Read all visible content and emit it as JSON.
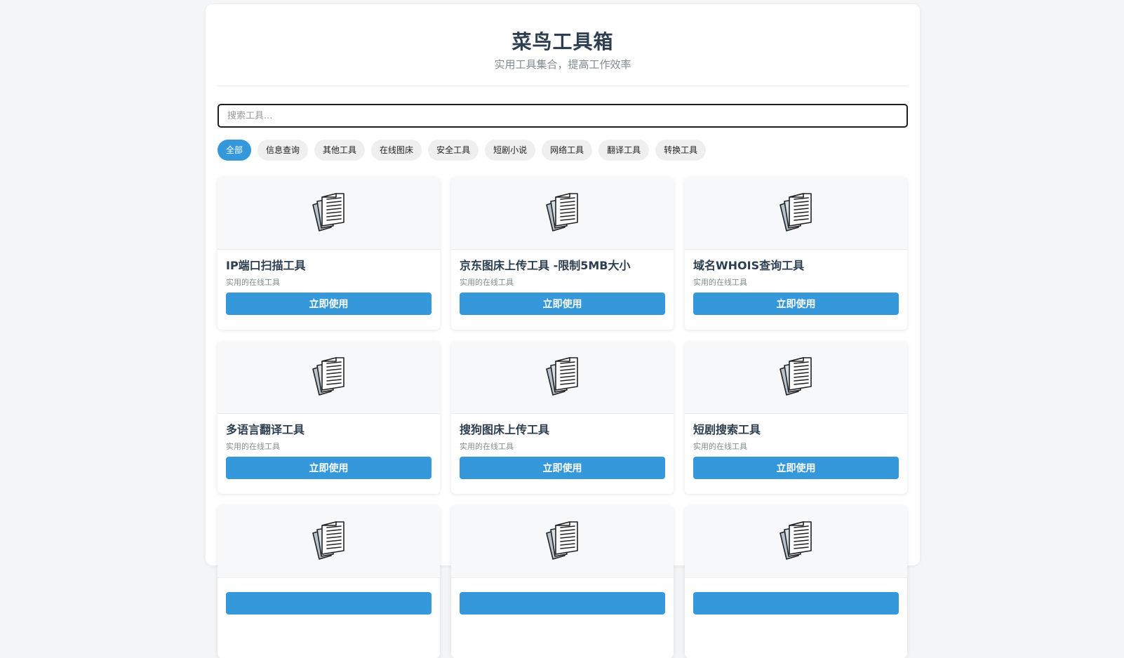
{
  "header": {
    "title": "菜鸟工具箱",
    "subtitle": "实用工具集合，提高工作效率"
  },
  "search": {
    "placeholder": "搜索工具..."
  },
  "categories": [
    {
      "label": "全部",
      "active": true
    },
    {
      "label": "信息查询"
    },
    {
      "label": "其他工具"
    },
    {
      "label": "在线图床"
    },
    {
      "label": "安全工具"
    },
    {
      "label": "短剧小说"
    },
    {
      "label": "网络工具"
    },
    {
      "label": "翻译工具"
    },
    {
      "label": "转换工具"
    }
  ],
  "tools": [
    {
      "title": "IP端口扫描工具",
      "desc": "实用的在线工具",
      "button": "立即使用",
      "icon": "documents-icon"
    },
    {
      "title": "京东图床上传工具 -限制5MB大小",
      "desc": "实用的在线工具",
      "button": "立即使用",
      "icon": "documents-icon"
    },
    {
      "title": "域名WHOIS查询工具",
      "desc": "实用的在线工具",
      "button": "立即使用",
      "icon": "documents-icon"
    },
    {
      "title": "多语言翻译工具",
      "desc": "实用的在线工具",
      "button": "立即使用",
      "icon": "documents-icon"
    },
    {
      "title": "搜狗图床上传工具",
      "desc": "实用的在线工具",
      "button": "立即使用",
      "icon": "documents-icon"
    },
    {
      "title": "短剧搜索工具",
      "desc": "实用的在线工具",
      "button": "立即使用",
      "icon": "documents-icon"
    },
    {
      "title": "",
      "desc": "",
      "button": "",
      "icon": "documents-icon"
    },
    {
      "title": "",
      "desc": "",
      "button": "",
      "icon": "documents-icon"
    },
    {
      "title": "",
      "desc": "",
      "button": "",
      "icon": "documents-icon"
    }
  ],
  "colors": {
    "accent": "#3498db",
    "title": "#2c3e50",
    "muted": "#7f8c8d"
  }
}
